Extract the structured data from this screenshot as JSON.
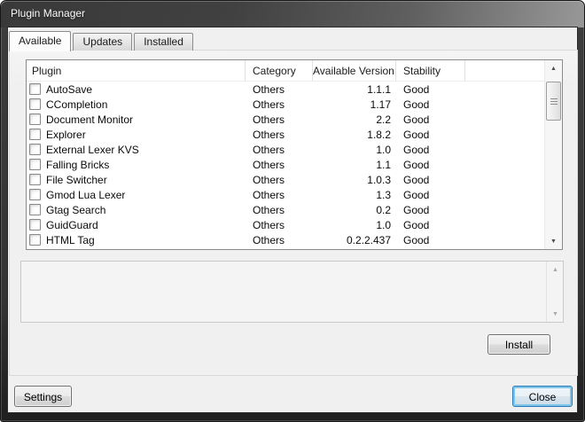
{
  "window": {
    "title": "Plugin Manager"
  },
  "tabs": [
    {
      "label": "Available",
      "active": true
    },
    {
      "label": "Updates",
      "active": false
    },
    {
      "label": "Installed",
      "active": false
    }
  ],
  "table": {
    "columns": [
      "Plugin",
      "Category",
      "Available Version",
      "Stability"
    ],
    "rows": [
      {
        "plugin": "AutoSave",
        "category": "Others",
        "version": "1.1.1",
        "stability": "Good",
        "checked": false
      },
      {
        "plugin": "CCompletion",
        "category": "Others",
        "version": "1.17",
        "stability": "Good",
        "checked": false
      },
      {
        "plugin": "Document Monitor",
        "category": "Others",
        "version": "2.2",
        "stability": "Good",
        "checked": false
      },
      {
        "plugin": "Explorer",
        "category": "Others",
        "version": "1.8.2",
        "stability": "Good",
        "checked": false
      },
      {
        "plugin": "External Lexer KVS",
        "category": "Others",
        "version": "1.0",
        "stability": "Good",
        "checked": false
      },
      {
        "plugin": "Falling Bricks",
        "category": "Others",
        "version": "1.1",
        "stability": "Good",
        "checked": false
      },
      {
        "plugin": "File Switcher",
        "category": "Others",
        "version": "1.0.3",
        "stability": "Good",
        "checked": false
      },
      {
        "plugin": "Gmod Lua Lexer",
        "category": "Others",
        "version": "1.3",
        "stability": "Good",
        "checked": false
      },
      {
        "plugin": "Gtag Search",
        "category": "Others",
        "version": "0.2",
        "stability": "Good",
        "checked": false
      },
      {
        "plugin": "GuidGuard",
        "category": "Others",
        "version": "1.0",
        "stability": "Good",
        "checked": false
      },
      {
        "plugin": "HTML Tag",
        "category": "Others",
        "version": "0.2.2.437",
        "stability": "Good",
        "checked": false
      }
    ]
  },
  "description": {
    "text": ""
  },
  "buttons": {
    "install": "Install",
    "settings": "Settings",
    "close": "Close"
  },
  "icons": {
    "scroll_up": "▲",
    "scroll_down": "▼"
  },
  "colors": {
    "titlebar_dark": "#3f3f3f",
    "dialog_bg": "#f0f0f0",
    "default_button_border": "#2e7cb5",
    "default_button_glow": "#7fc5ea"
  }
}
